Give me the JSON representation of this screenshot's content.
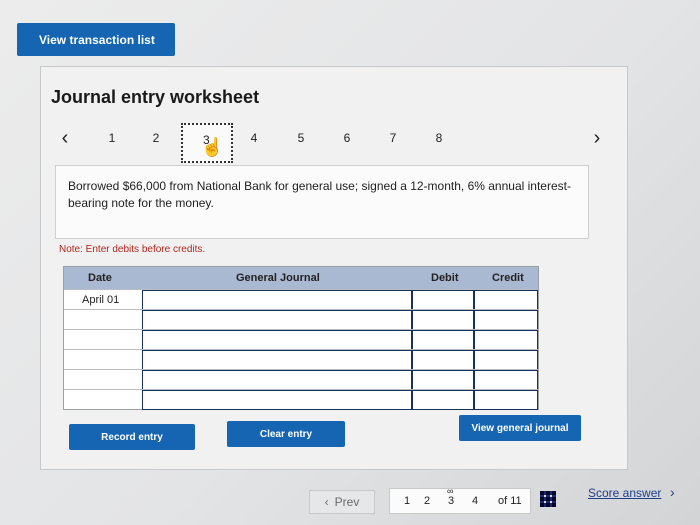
{
  "top": {
    "view_transaction_list": "View transaction list"
  },
  "worksheet": {
    "title": "Journal entry worksheet",
    "tabs": [
      "1",
      "2",
      "3",
      "4",
      "5",
      "6",
      "7",
      "8"
    ],
    "active_tab": "3",
    "prev_chevron": "‹",
    "next_chevron": "›",
    "description": "Borrowed $66,000 from National Bank for general use; signed a 12-month, 6% annual interest-bearing note for the money.",
    "note": "Note: Enter debits before credits."
  },
  "journal": {
    "headers": {
      "date": "Date",
      "general_journal": "General Journal",
      "debit": "Debit",
      "credit": "Credit"
    },
    "rows": [
      {
        "date": "April 01",
        "account": "",
        "debit": "",
        "credit": ""
      },
      {
        "date": "",
        "account": "",
        "debit": "",
        "credit": ""
      },
      {
        "date": "",
        "account": "",
        "debit": "",
        "credit": ""
      },
      {
        "date": "",
        "account": "",
        "debit": "",
        "credit": ""
      },
      {
        "date": "",
        "account": "",
        "debit": "",
        "credit": ""
      },
      {
        "date": "",
        "account": "",
        "debit": "",
        "credit": ""
      }
    ]
  },
  "buttons": {
    "record_entry": "Record entry",
    "clear_entry": "Clear entry",
    "view_general_journal": "View general journal"
  },
  "footer": {
    "prev": "Prev",
    "pages": [
      "1",
      "2",
      "3",
      "4"
    ],
    "of_total": "of 11",
    "score_answer": "Score answer"
  },
  "colors": {
    "primary_button": "#1565b3",
    "table_header": "#a9b9d1",
    "note_text": "#b3261e"
  },
  "icons": [
    "hand-pointer-icon",
    "grid-icon",
    "chevron-left-icon",
    "chevron-right-icon",
    "link-icon"
  ]
}
